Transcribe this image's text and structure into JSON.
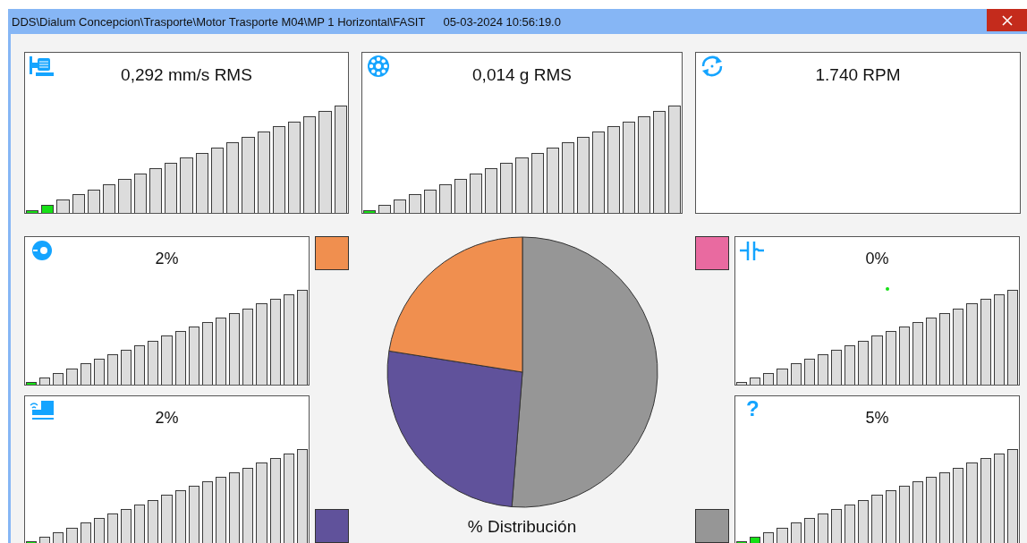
{
  "window": {
    "title": "DDS\\Dialum Concepcion\\Trasporte\\Motor Trasporte M04\\MP 1 Horizontal\\FASIT",
    "timestamp": "05-03-2024 10:56:19.0"
  },
  "cards": [
    {
      "kind": "meter",
      "reading": "0,292 mm/s RMS",
      "level": 0.095
    },
    {
      "kind": "meter",
      "reading": "0,014 g RMS",
      "level": 0.048
    },
    {
      "kind": "reading",
      "reading": "1.740 RPM"
    },
    {
      "kind": "meter",
      "reading": "2%",
      "level": 0.048,
      "color": "#f08f4f"
    },
    {
      "kind": "meter",
      "reading": "2%",
      "level": 0.048,
      "color": "#60529b"
    },
    {
      "kind": "meter",
      "reading": "0%",
      "level": 0,
      "color": "#e96aa0",
      "dot": true
    },
    {
      "kind": "meter",
      "reading": "5%",
      "level": 0.095,
      "color": "#969696",
      "icon_glyph": "?"
    }
  ],
  "distribution": {
    "caption": "% Distribución"
  }
}
